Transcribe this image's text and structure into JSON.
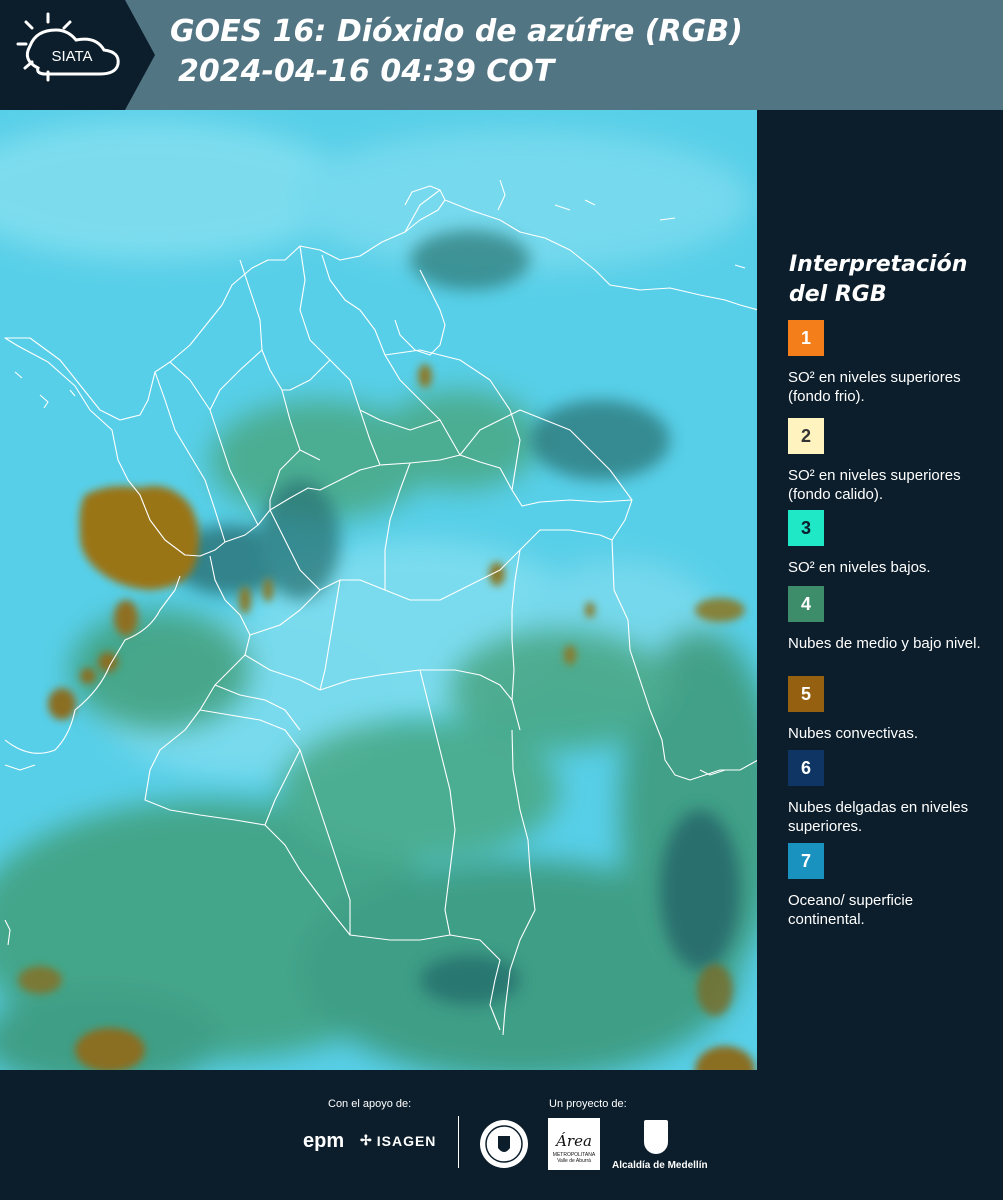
{
  "header": {
    "logo_text": "SIATA",
    "title_line1": "GOES 16: Dióxido de azúfre (RGB)",
    "title_line2": "2024-04-16 04:39 COT"
  },
  "legend": {
    "title": "Interpretación del RGB",
    "items": [
      {
        "number": "1",
        "color": "#f47f1a",
        "text_color": "#ffffff",
        "description": "SO² en niveles superiores (fondo frio)."
      },
      {
        "number": "2",
        "color": "#fff3c0",
        "text_color": "#333333",
        "description": "SO² en niveles superiores (fondo calido)."
      },
      {
        "number": "3",
        "color": "#1ee8c6",
        "text_color": "#0c1e2b",
        "description": "SO² en niveles bajos."
      },
      {
        "number": "4",
        "color": "#3e8d6a",
        "text_color": "#ffffff",
        "description": "Nubes de medio y bajo nivel."
      },
      {
        "number": "5",
        "color": "#95600f",
        "text_color": "#ffffff",
        "description": "Nubes convectivas."
      },
      {
        "number": "6",
        "color": "#0f3564",
        "text_color": "#ffffff",
        "description": "Nubes delgadas en niveles superiores."
      },
      {
        "number": "7",
        "color": "#1a92c0",
        "text_color": "#ffffff",
        "description": "Oceano/ superficie continental."
      }
    ]
  },
  "footer": {
    "support_label": "Con el apoyo de:",
    "project_label": "Un proyecto de:",
    "sponsor_logos": [
      "epm",
      "ISAGEN"
    ],
    "partner_logos": [
      "Medellín",
      "Área Metropolitana Valle de Aburrá",
      "Alcaldía de Medellín"
    ],
    "epm_text": "epm",
    "isagen_text": "ISAGEN",
    "area_text": "Área",
    "area_sub": "METROPOLITANA Valle de Aburrá",
    "alcaldia_text": "Alcaldía de Medellín"
  },
  "map": {
    "icon": "satellite-rgb-image",
    "colors": {
      "background": "#5ad2ea",
      "sky": "#8fe4f2",
      "green_cloud": "#3f9f7a",
      "dark_cloud": "#246a6a",
      "convective": "#9a7418",
      "border": "#ffffff"
    }
  }
}
